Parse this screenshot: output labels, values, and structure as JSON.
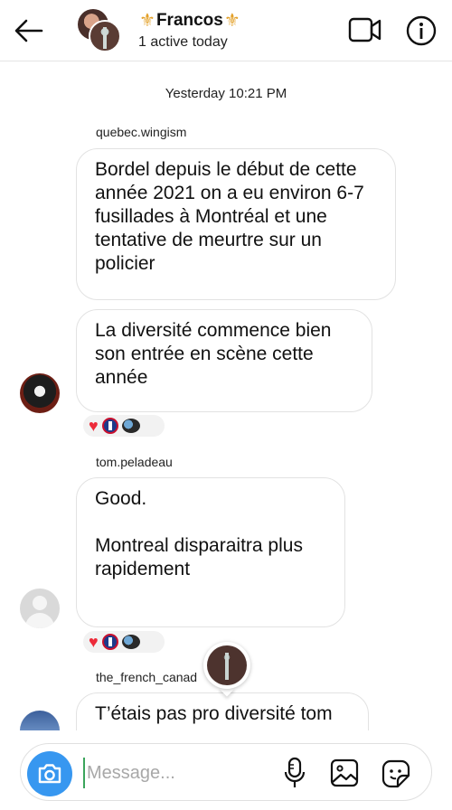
{
  "header": {
    "fleur_left": "⚜",
    "name": "Francos",
    "fleur_right": "⚜",
    "status": "1 active today"
  },
  "thread": {
    "timestamp": "Yesterday 10:21 PM",
    "messages": [
      {
        "sender": "quebec.wingism",
        "text": "Bordel depuis le début de cette année 2021 on a eu environ 6-7 fusillades à Montréal et une tentative de meurtre sur un policier"
      },
      {
        "sender": "",
        "text": "La diversité commence bien son entrée en scène cette année"
      },
      {
        "sender": "tom.peladeau",
        "text": "Good.\n\nMontreal disparaitra plus rapidement"
      },
      {
        "sender": "the_french_canad",
        "text": "T’étais pas pro diversité tom"
      }
    ],
    "reactions": [
      "heart",
      "habs-logo",
      "hockey-puck"
    ]
  },
  "composer": {
    "placeholder": "Message..."
  },
  "colors": {
    "accent": "#3797f0",
    "heart": "#ed2b3a",
    "fleur": "#e3a12a"
  }
}
